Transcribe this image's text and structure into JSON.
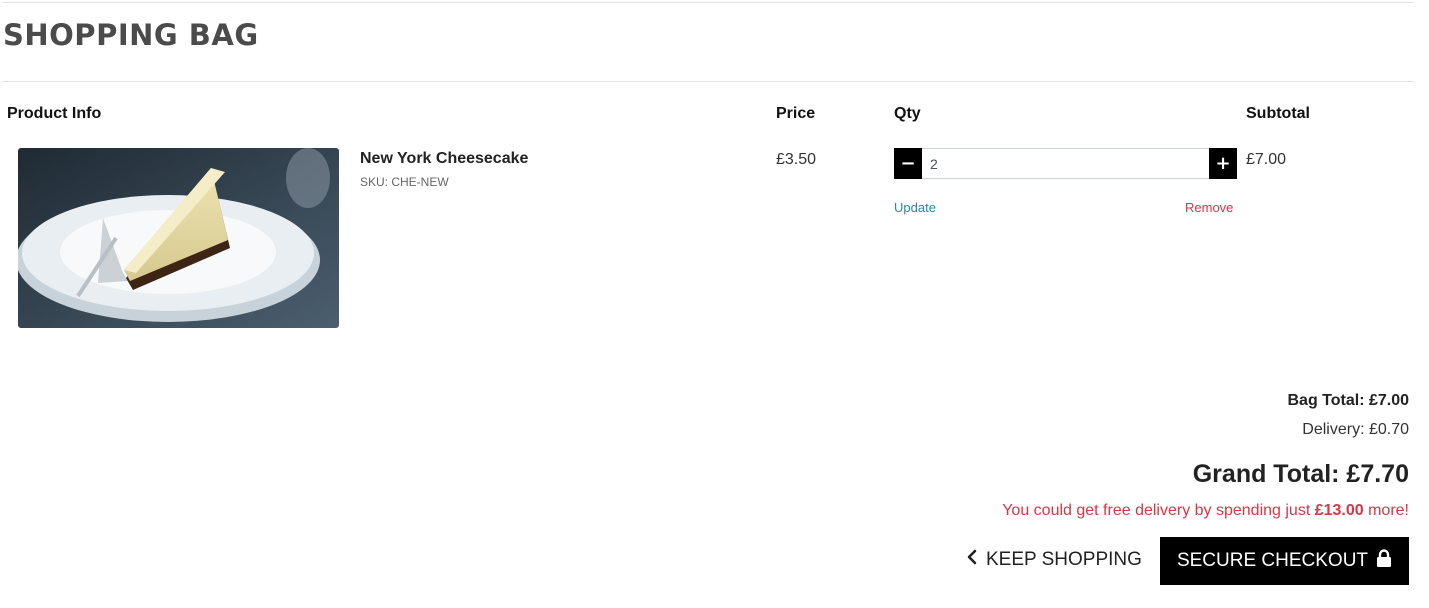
{
  "page": {
    "title": "SHOPPING BAG"
  },
  "table": {
    "headers": {
      "product": "Product Info",
      "price": "Price",
      "qty": "Qty",
      "subtotal": "Subtotal"
    }
  },
  "item": {
    "name": "New York Cheesecake",
    "sku": "SKU: CHE-NEW",
    "price": "£3.50",
    "qty": "2",
    "subtotal": "£7.00",
    "update": "Update",
    "remove": "Remove",
    "minus": "−",
    "plus": "+"
  },
  "totals": {
    "bag_total": "Bag Total: £7.00",
    "delivery": "Delivery: £0.70",
    "grand_total": "Grand Total: £7.70",
    "free_delivery_prefix": "You could get free delivery by spending just ",
    "free_delivery_amount": "£13.00",
    "free_delivery_suffix": " more!"
  },
  "actions": {
    "keep_shopping": "KEEP SHOPPING",
    "keep_shopping_icon": "chevron-left-icon",
    "checkout": "SECURE CHECKOUT",
    "checkout_icon": "lock-icon"
  },
  "colors": {
    "accent_link": "#1791a8",
    "danger": "#dc3545",
    "button_bg": "#000000"
  }
}
